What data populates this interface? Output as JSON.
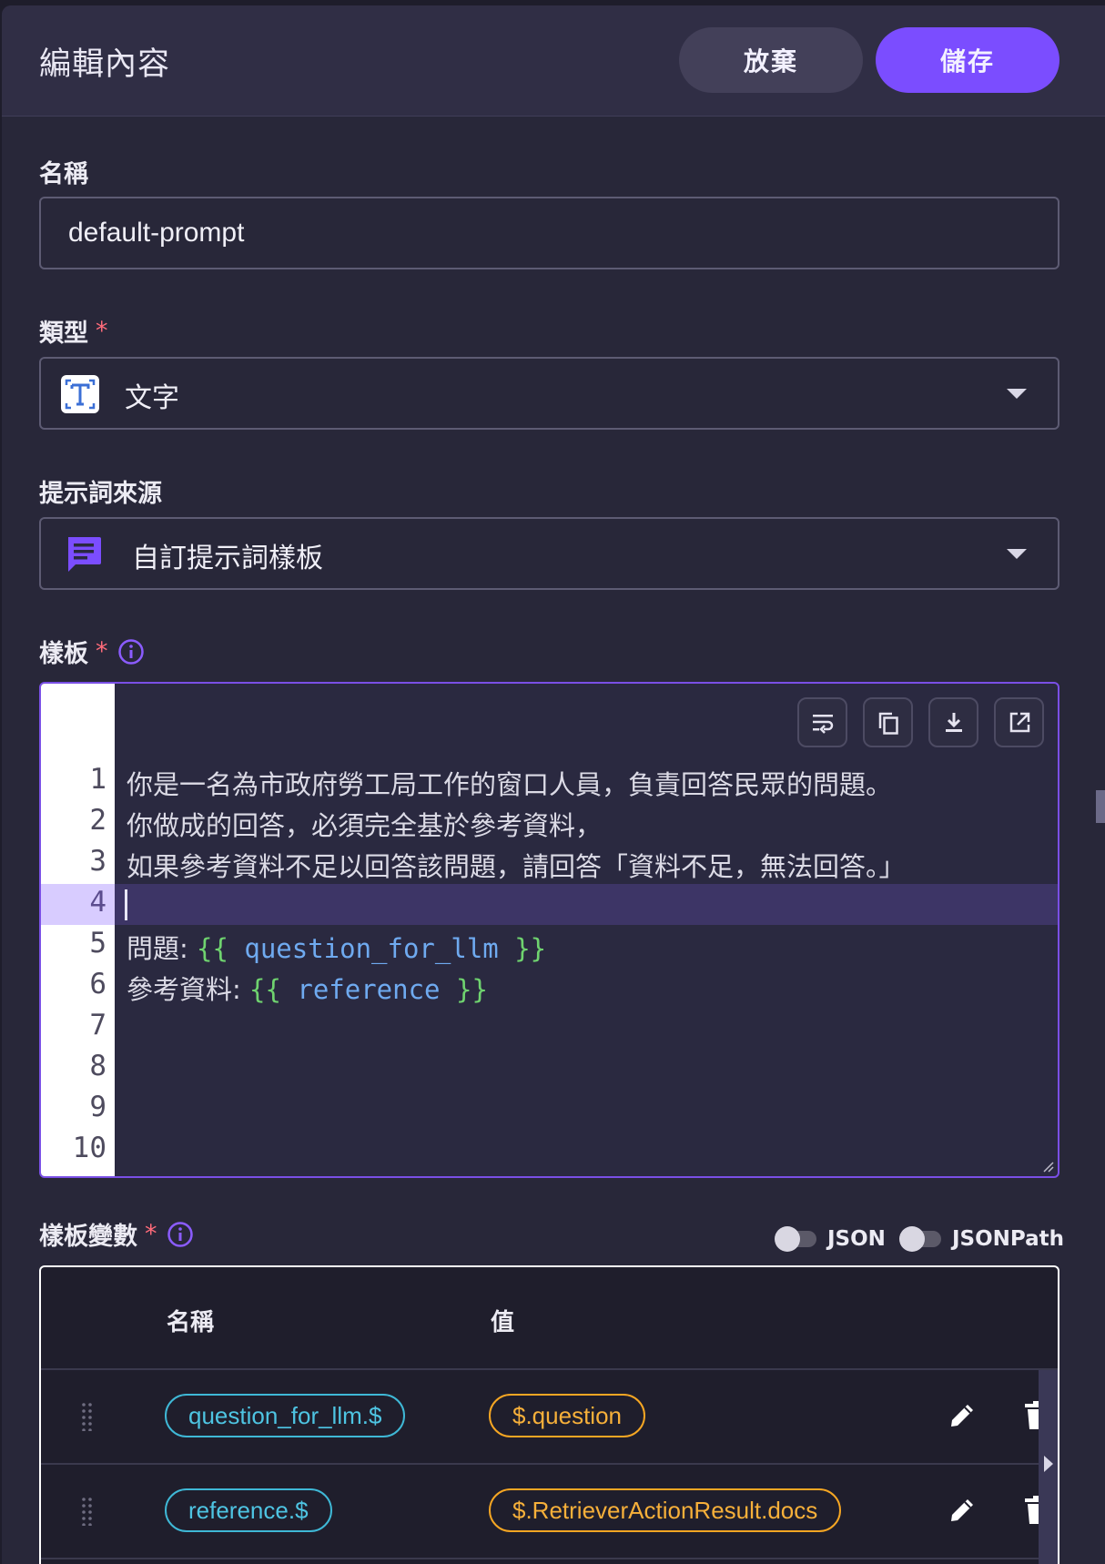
{
  "header": {
    "title": "編輯內容",
    "discard_label": "放棄",
    "save_label": "儲存"
  },
  "name_field": {
    "label": "名稱",
    "value": "default-prompt"
  },
  "type_field": {
    "label": "類型",
    "required_mark": "*",
    "value": "文字",
    "icon": "text-type-icon"
  },
  "source_field": {
    "label": "提示詞來源",
    "value": "自訂提示詞樣板",
    "icon": "chat-message-icon"
  },
  "template": {
    "label": "樣板",
    "required_mark": "*",
    "line_numbers": [
      "1",
      "2",
      "3",
      "4",
      "5",
      "6",
      "7",
      "8",
      "9",
      "10"
    ],
    "lines": {
      "l1": "你是一名為市政府勞工局工作的窗口人員，負責回答民眾的問題。",
      "l2": "你做成的回答，必須完全基於參考資料，",
      "l3": "如果參考資料不足以回答該問題，請回答「資料不足，無法回答。」",
      "l5_prefix": "問題: ",
      "l5_open": "{{",
      "l5_var": " question_for_llm ",
      "l5_close": "}}",
      "l6_prefix": "參考資料: ",
      "l6_open": "{{",
      "l6_var": " reference ",
      "l6_close": "}}"
    },
    "toolbar_icons": [
      "wrap-lines-icon",
      "copy-icon",
      "download-icon",
      "open-external-icon"
    ]
  },
  "variables": {
    "label": "樣板變數",
    "required_mark": "*",
    "toggle_json": "JSON",
    "toggle_jsonpath": "JSONPath",
    "col_name": "名稱",
    "col_value": "值",
    "rows": [
      {
        "name": "question_for_llm.$",
        "value": "$.question"
      },
      {
        "name": "reference.$",
        "value": "$.RetrieverActionResult.docs"
      }
    ]
  },
  "colors": {
    "accent": "#7b4dff",
    "chip_name": "#4ec4e2",
    "chip_value": "#f7b03a",
    "template_brace": "#6fd36f",
    "template_var": "#6faaf0"
  }
}
